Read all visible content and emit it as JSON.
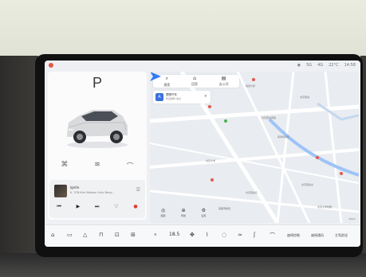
{
  "colors": {
    "accent": "#3a6fe0",
    "map_route": "#2f7bf6",
    "alert": "#e23c2d",
    "bg": "#eef0f3"
  },
  "status": {
    "location_icon": "location-pin-icon",
    "items": [
      "5G",
      "4G",
      "22°C",
      "14:58"
    ]
  },
  "vehicle": {
    "gear": "P",
    "controls": [
      "lock-icon",
      "fan-icon",
      "trunk-icon"
    ]
  },
  "music": {
    "title": "Ignite",
    "artist": "K. 376-Kim Nielsen Gulu Berg...",
    "more_icon": "list-icon",
    "controls": [
      "prev-icon",
      "play-icon",
      "next-icon",
      "heart-icon",
      "record-icon"
    ]
  },
  "map": {
    "search": [
      {
        "icon": "search-icon",
        "label": "搜索"
      },
      {
        "icon": "home-icon",
        "label": "回家"
      },
      {
        "icon": "office-icon",
        "label": "去公司"
      }
    ],
    "destination": {
      "badge": "A",
      "title": "理想汽车",
      "subtitle": "附近推荐·地点",
      "close": "×"
    },
    "labels": [
      "恒通大厦",
      "北京西站",
      "北京西站南路",
      "丽泽商务区",
      "北京大学",
      "北京西站北",
      "北京西站东",
      "首都博物馆",
      "北京大学附属"
    ],
    "tools": [
      {
        "icon": "layers-icon",
        "label": "图层"
      },
      {
        "icon": "compass-icon",
        "label": "导航"
      },
      {
        "icon": "settings-icon",
        "label": "设置"
      }
    ],
    "scale": "200m"
  },
  "dock": {
    "icons_left": [
      "home-icon",
      "media-icon",
      "nav-icon",
      "car-icon",
      "seat-icon",
      "apps-icon"
    ],
    "temp_left": "18.5",
    "icons_mid": [
      "fan-icon",
      "ac-icon",
      "defrost-icon",
      "steering-icon",
      "heat-icon",
      "seat-heat-icon"
    ],
    "labels_right": [
      "座椅控制",
      "座椅通风",
      "主驾舒适"
    ]
  }
}
